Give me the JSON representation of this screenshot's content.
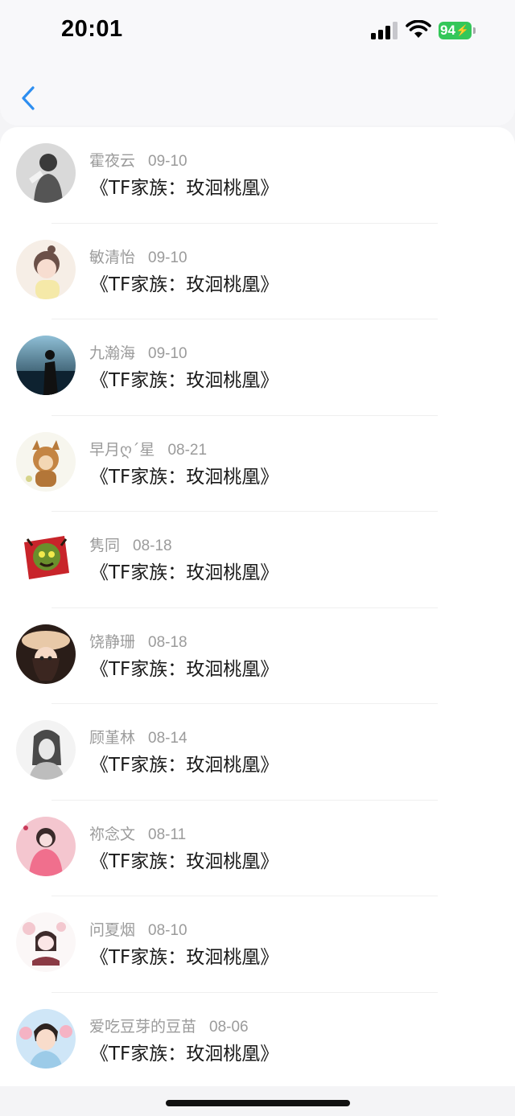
{
  "status_bar": {
    "time": "20:01",
    "battery_level": "94",
    "battery_color": "#34c759"
  },
  "nav": {
    "back_icon": "chevron-left-icon",
    "accent_color": "#1e90ff"
  },
  "items": [
    {
      "name": "霍夜云",
      "date": "09-10",
      "title": "《TF家族：玫洄桃凰》"
    },
    {
      "name": "敏清怡",
      "date": "09-10",
      "title": "《TF家族：玫洄桃凰》"
    },
    {
      "name": "九瀚海",
      "date": "09-10",
      "title": "《TF家族：玫洄桃凰》"
    },
    {
      "name": "早月ღ´星",
      "date": "08-21",
      "title": "《TF家族：玫洄桃凰》"
    },
    {
      "name": "隽同",
      "date": "08-18",
      "title": "《TF家族：玫洄桃凰》"
    },
    {
      "name": "饶静珊",
      "date": "08-18",
      "title": "《TF家族：玫洄桃凰》"
    },
    {
      "name": "顾堇林",
      "date": "08-14",
      "title": "《TF家族：玫洄桃凰》"
    },
    {
      "name": "祢念文",
      "date": "08-11",
      "title": "《TF家族：玫洄桃凰》"
    },
    {
      "name": "问夏烟",
      "date": "08-10",
      "title": "《TF家族：玫洄桃凰》"
    },
    {
      "name": "爱吃豆芽的豆苗",
      "date": "08-06",
      "title": "《TF家族：玫洄桃凰》"
    }
  ]
}
